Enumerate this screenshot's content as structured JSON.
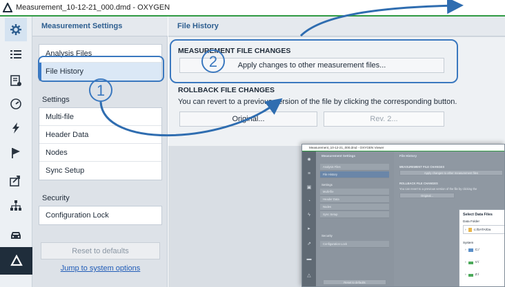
{
  "window": {
    "title": "Measurement_10-12-21_000.dmd - OXYGEN"
  },
  "rail": {
    "icons": [
      "settings-gear-icon",
      "list-icon",
      "report-icon",
      "gauge-icon",
      "lightning-icon",
      "play-flag-icon",
      "export-icon",
      "network-icon",
      "car-icon",
      "oxygen-logo-icon"
    ]
  },
  "nav": {
    "header": "Measurement Settings",
    "group1": [
      {
        "label": "Analysis Files"
      },
      {
        "label": "File History"
      }
    ],
    "settings_label": "Settings",
    "group2": [
      {
        "label": "Multi-file"
      },
      {
        "label": "Header Data"
      },
      {
        "label": "Nodes"
      },
      {
        "label": "Sync Setup"
      }
    ],
    "security_label": "Security",
    "group3": [
      {
        "label": "Configuration Lock"
      }
    ],
    "reset_label": "Reset to defaults",
    "jump_link": "Jump to system options"
  },
  "main": {
    "header": "File History",
    "measurement_changes": {
      "title": "MEASUREMENT FILE CHANGES",
      "apply_button": "Apply changes to other measurement files..."
    },
    "rollback": {
      "title": "ROLLBACK FILE CHANGES",
      "description": "You can revert to a previous version of the file by clicking the corresponding button.",
      "original_button": "Original...",
      "rev_button": "Rev. 2..."
    }
  },
  "callouts": {
    "step1": "1",
    "step2": "2"
  },
  "inset": {
    "title": "Measurement_10-12-21_000.dmd - OXYGEN Viewer",
    "nav_header": "Measurement Settings",
    "main_header": "File History",
    "items1": [
      "Analysis Files",
      "File History"
    ],
    "settings_label": "Settings",
    "items2": [
      "Multi-file",
      "Header Data",
      "Nodes",
      "Sync Setup"
    ],
    "security_label": "Security",
    "items3": [
      "Configuration Lock"
    ],
    "reset_label": "Reset to defaults",
    "measurement_title": "MEASUREMENT FILE CHANGES",
    "apply_button": "Apply changes to other measurement files",
    "rollback_title": "ROLLBACK FILE CHANGES",
    "rollback_desc": "You can revert to a previous version of the file by clicking the",
    "original_button": "Original...",
    "dialog": {
      "title": "Select Data Files",
      "folder_label": "Data Folder",
      "folder_value": "c:/DATA/Da",
      "system_label": "System",
      "drives": [
        "C:/",
        "V:/",
        "Z:/"
      ]
    }
  },
  "colors": {
    "accent": "#3a7bc8",
    "callout": "#2f6db0",
    "titlebar_line": "#2f9a43"
  }
}
